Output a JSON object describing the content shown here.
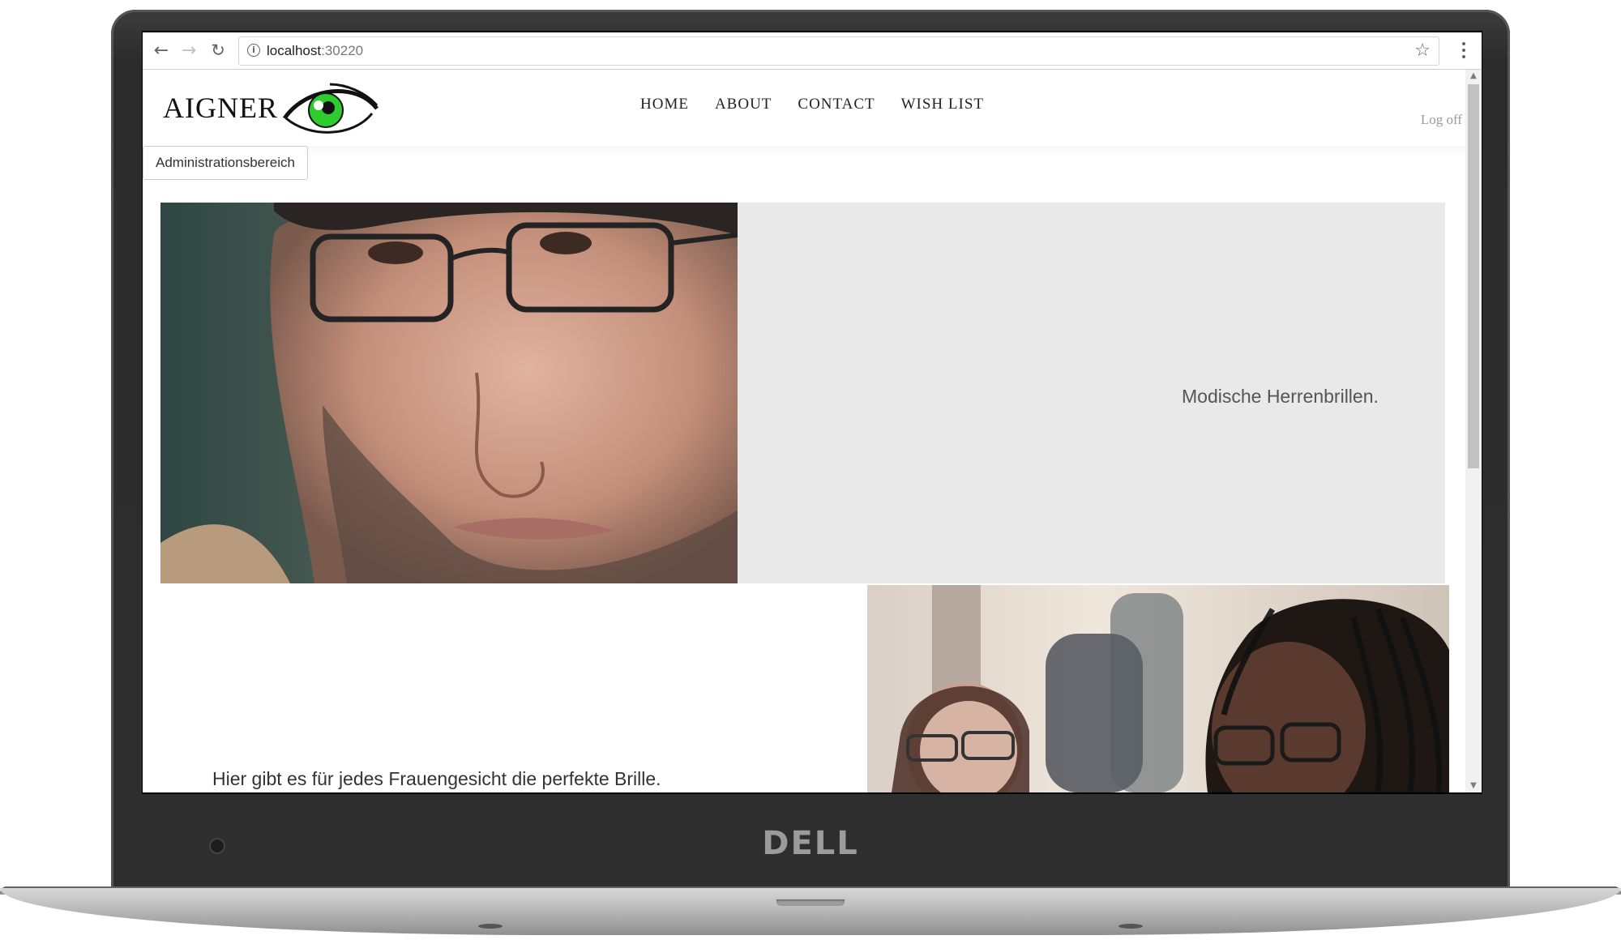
{
  "device": {
    "brand_logo": "DELL"
  },
  "browser": {
    "url_host": "localhost",
    "url_port": ":30220",
    "icons": [
      "back-arrow-icon",
      "forward-arrow-icon",
      "reload-icon",
      "info-icon",
      "star-icon",
      "menu-icon"
    ]
  },
  "site": {
    "brand": "AIGNER",
    "nav": [
      "HOME",
      "ABOUT",
      "CONTACT",
      "WISH LIST"
    ],
    "logoff": "Log off",
    "admin_button": "Administrationsbereich"
  },
  "content": {
    "men_caption": "Modische Herrenbrillen.",
    "women_caption": "Hier gibt es für jedes Frauengesicht die perfekte Brille."
  },
  "colors": {
    "eye_green": "#2ecc2e",
    "hero_bg": "#e9e9e9"
  }
}
